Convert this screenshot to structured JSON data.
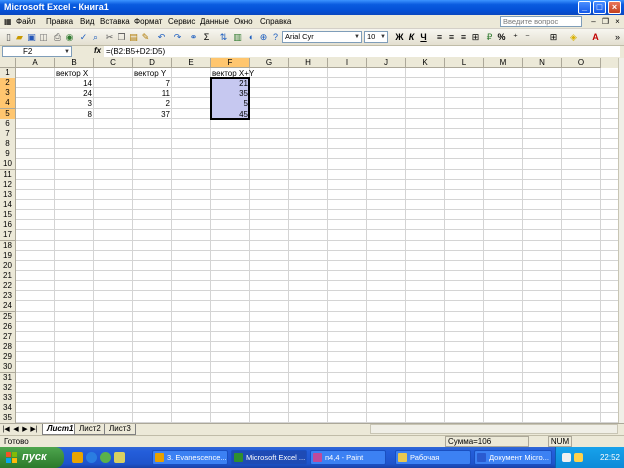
{
  "window": {
    "title": "Microsoft Excel - Книга1"
  },
  "menu": {
    "items": [
      "Файл",
      "Правка",
      "Вид",
      "Вставка",
      "Формат",
      "Сервис",
      "Данные",
      "Окно",
      "Справка"
    ],
    "help_placeholder": "Введите вопрос"
  },
  "toolbar": {
    "font": "Arial Cyr",
    "size": "10",
    "bold": "Ж",
    "italic": "К",
    "underline": "Ч",
    "percent": "%",
    "sigma": "Σ"
  },
  "formula_bar": {
    "name_box": "F2",
    "fx": "fx",
    "formula": "=(B2:B5+D2:D5)"
  },
  "columns": [
    "A",
    "B",
    "C",
    "D",
    "E",
    "F",
    "G",
    "H",
    "I",
    "J",
    "K",
    "L",
    "M",
    "N",
    "O"
  ],
  "selected_column": "F",
  "rows": [
    "1",
    "2",
    "3",
    "4",
    "5",
    "6",
    "7",
    "8",
    "9",
    "10",
    "11",
    "12",
    "13",
    "14",
    "15",
    "16",
    "17",
    "18",
    "19",
    "20",
    "21",
    "22",
    "23",
    "24",
    "25",
    "26",
    "27",
    "28",
    "29",
    "30",
    "31",
    "32",
    "33",
    "34",
    "35"
  ],
  "cells": {
    "B1": "вектор X",
    "D1": "вектор Y",
    "F1": "вектор X+Y",
    "B2": "14",
    "D2": "7",
    "F2": "21",
    "B3": "24",
    "D3": "11",
    "F3": "35",
    "B4": "3",
    "D4": "2",
    "F4": "5",
    "B5": "8",
    "D5": "37",
    "F5": "45"
  },
  "sheets": [
    "Лист1",
    "Лист2",
    "Лист3"
  ],
  "active_sheet": "Лист1",
  "status": {
    "ready": "Готово",
    "sum": "Сумма=106",
    "num": "NUM"
  },
  "taskbar": {
    "start": "пуск",
    "tasks": [
      "3. Evanescence...",
      "Microsoft Excel ...",
      "п4,4 - Paint",
      "Рабочая",
      "Документ Micro..."
    ],
    "active_task": "Microsoft Excel ...",
    "clock": "22:52"
  },
  "colors": {
    "title_bar": "#0450d6",
    "selection_fill": "#c6c8f0",
    "header_highlight": "#ffc66f",
    "taskbar": "#245edb",
    "start_button": "#3c8f3c"
  }
}
